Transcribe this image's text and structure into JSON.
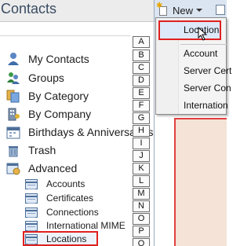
{
  "header": {
    "title": "Contacts"
  },
  "nav": [
    {
      "label": "My Contacts",
      "icon": "my-contacts-icon"
    },
    {
      "label": "Groups",
      "icon": "groups-icon"
    },
    {
      "label": "By Category",
      "icon": "category-icon"
    },
    {
      "label": "By Company",
      "icon": "company-icon"
    },
    {
      "label": "Birthdays & Anniversaries",
      "icon": "calendar-icon"
    },
    {
      "label": "Trash",
      "icon": "trash-icon"
    },
    {
      "label": "Advanced",
      "icon": "advanced-icon"
    }
  ],
  "advanced_items": [
    {
      "label": "Accounts"
    },
    {
      "label": "Certificates"
    },
    {
      "label": "Connections"
    },
    {
      "label": "International MIME"
    },
    {
      "label": "Locations"
    }
  ],
  "alphabet": [
    "A",
    "B",
    "C",
    "D",
    "E",
    "F",
    "G",
    "H",
    "I",
    "J",
    "K",
    "L",
    "M",
    "N",
    "O",
    "P",
    "Q"
  ],
  "toolbar": {
    "new_label": "New"
  },
  "new_menu": {
    "highlighted": "Location",
    "items": [
      "Account",
      "Server Cert",
      "Server Con",
      "Internation"
    ]
  },
  "colors": {
    "highlight_border": "#e02020",
    "menu_highlight": "#dde9f8",
    "peach": "#f4e3d6"
  }
}
